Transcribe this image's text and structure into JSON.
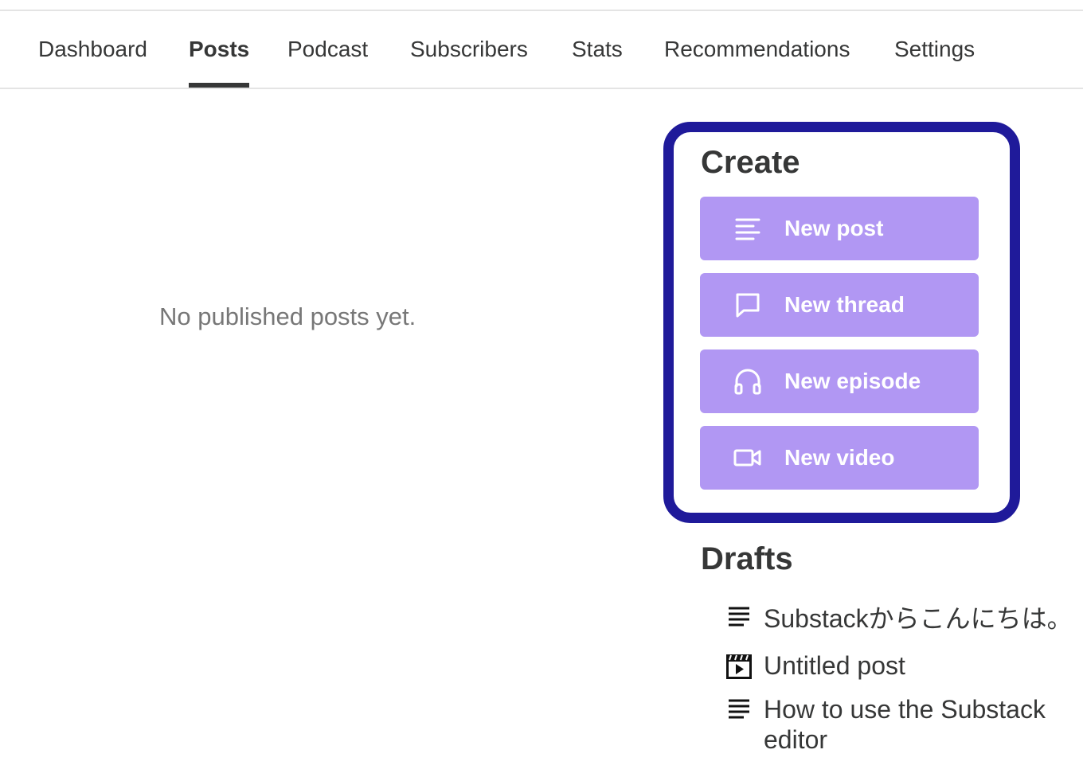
{
  "nav": {
    "tabs": [
      {
        "label": "Dashboard"
      },
      {
        "label": "Posts"
      },
      {
        "label": "Podcast"
      },
      {
        "label": "Subscribers"
      },
      {
        "label": "Stats"
      },
      {
        "label": "Recommendations"
      },
      {
        "label": "Settings"
      }
    ],
    "active_tab": "Posts"
  },
  "main": {
    "empty_message": "No published posts yet."
  },
  "create": {
    "title": "Create",
    "buttons": [
      {
        "label": "New post",
        "icon": "text-lines-icon"
      },
      {
        "label": "New thread",
        "icon": "speech-bubble-icon"
      },
      {
        "label": "New episode",
        "icon": "headphones-icon"
      },
      {
        "label": "New video",
        "icon": "video-camera-icon"
      }
    ]
  },
  "drafts": {
    "title": "Drafts",
    "items": [
      {
        "title": "Substackからこんにちは。",
        "icon": "text-lines-icon"
      },
      {
        "title": "Untitled post",
        "icon": "video-clapper-icon"
      },
      {
        "title": "How to use the Substack editor",
        "icon": "text-lines-icon"
      }
    ]
  },
  "colors": {
    "accent_button": "#b197f3",
    "highlight_border": "#1f1a9a",
    "text": "#363737",
    "muted_text": "#777777"
  }
}
